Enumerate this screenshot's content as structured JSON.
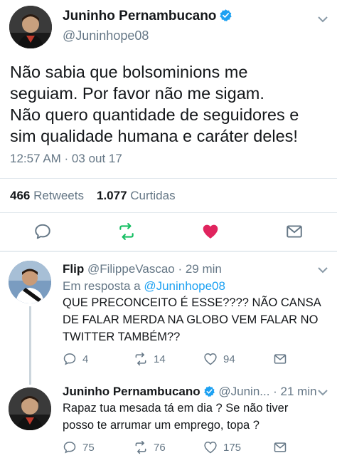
{
  "tweet": {
    "name": "Juninho Pernambucano",
    "handle": "@Juninhope08",
    "lines": [
      "Não sabia que bolsominions me",
      "seguiam. Por favor não me sigam.",
      "Não quero quantidade de seguidores e",
      "sim qualidade humana e caráter deles!"
    ],
    "timestamp": "12:57 AM · 03 out 17",
    "retweets_count": "466",
    "retweets_label": "Retweets",
    "likes_count": "1.077",
    "likes_label": "Curtidas"
  },
  "replies": [
    {
      "name": "Flip",
      "handle_time": "@FilippeVascao · 29 min",
      "in_reply_prefix": "Em resposta a",
      "in_reply_handle": "@Juninhope08",
      "lines": [
        "QUE PRECONCEITO É ESSE???? NÃO CANSA",
        "DE FALAR MERDA NA GLOBO VEM FALAR NO",
        "TWITTER TAMBÉM??"
      ],
      "reply_count": "4",
      "retweet_count": "14",
      "like_count": "94"
    },
    {
      "name": "Juninho Pernambucano",
      "handle_time": "@Junin... · 21 min",
      "lines": [
        "Rapaz tua mesada tá em dia ? Se não tiver",
        "posso te arrumar um emprego, topa ?"
      ],
      "reply_count": "75",
      "retweet_count": "76",
      "like_count": "175"
    }
  ],
  "colors": {
    "accent": "#1da1f2",
    "retweet_green": "#17bf63",
    "like_red": "#e0245e",
    "muted": "#657786"
  },
  "icons": [
    "verified-icon",
    "chevron-down-icon",
    "reply-icon",
    "retweet-icon",
    "like-icon",
    "message-icon"
  ]
}
